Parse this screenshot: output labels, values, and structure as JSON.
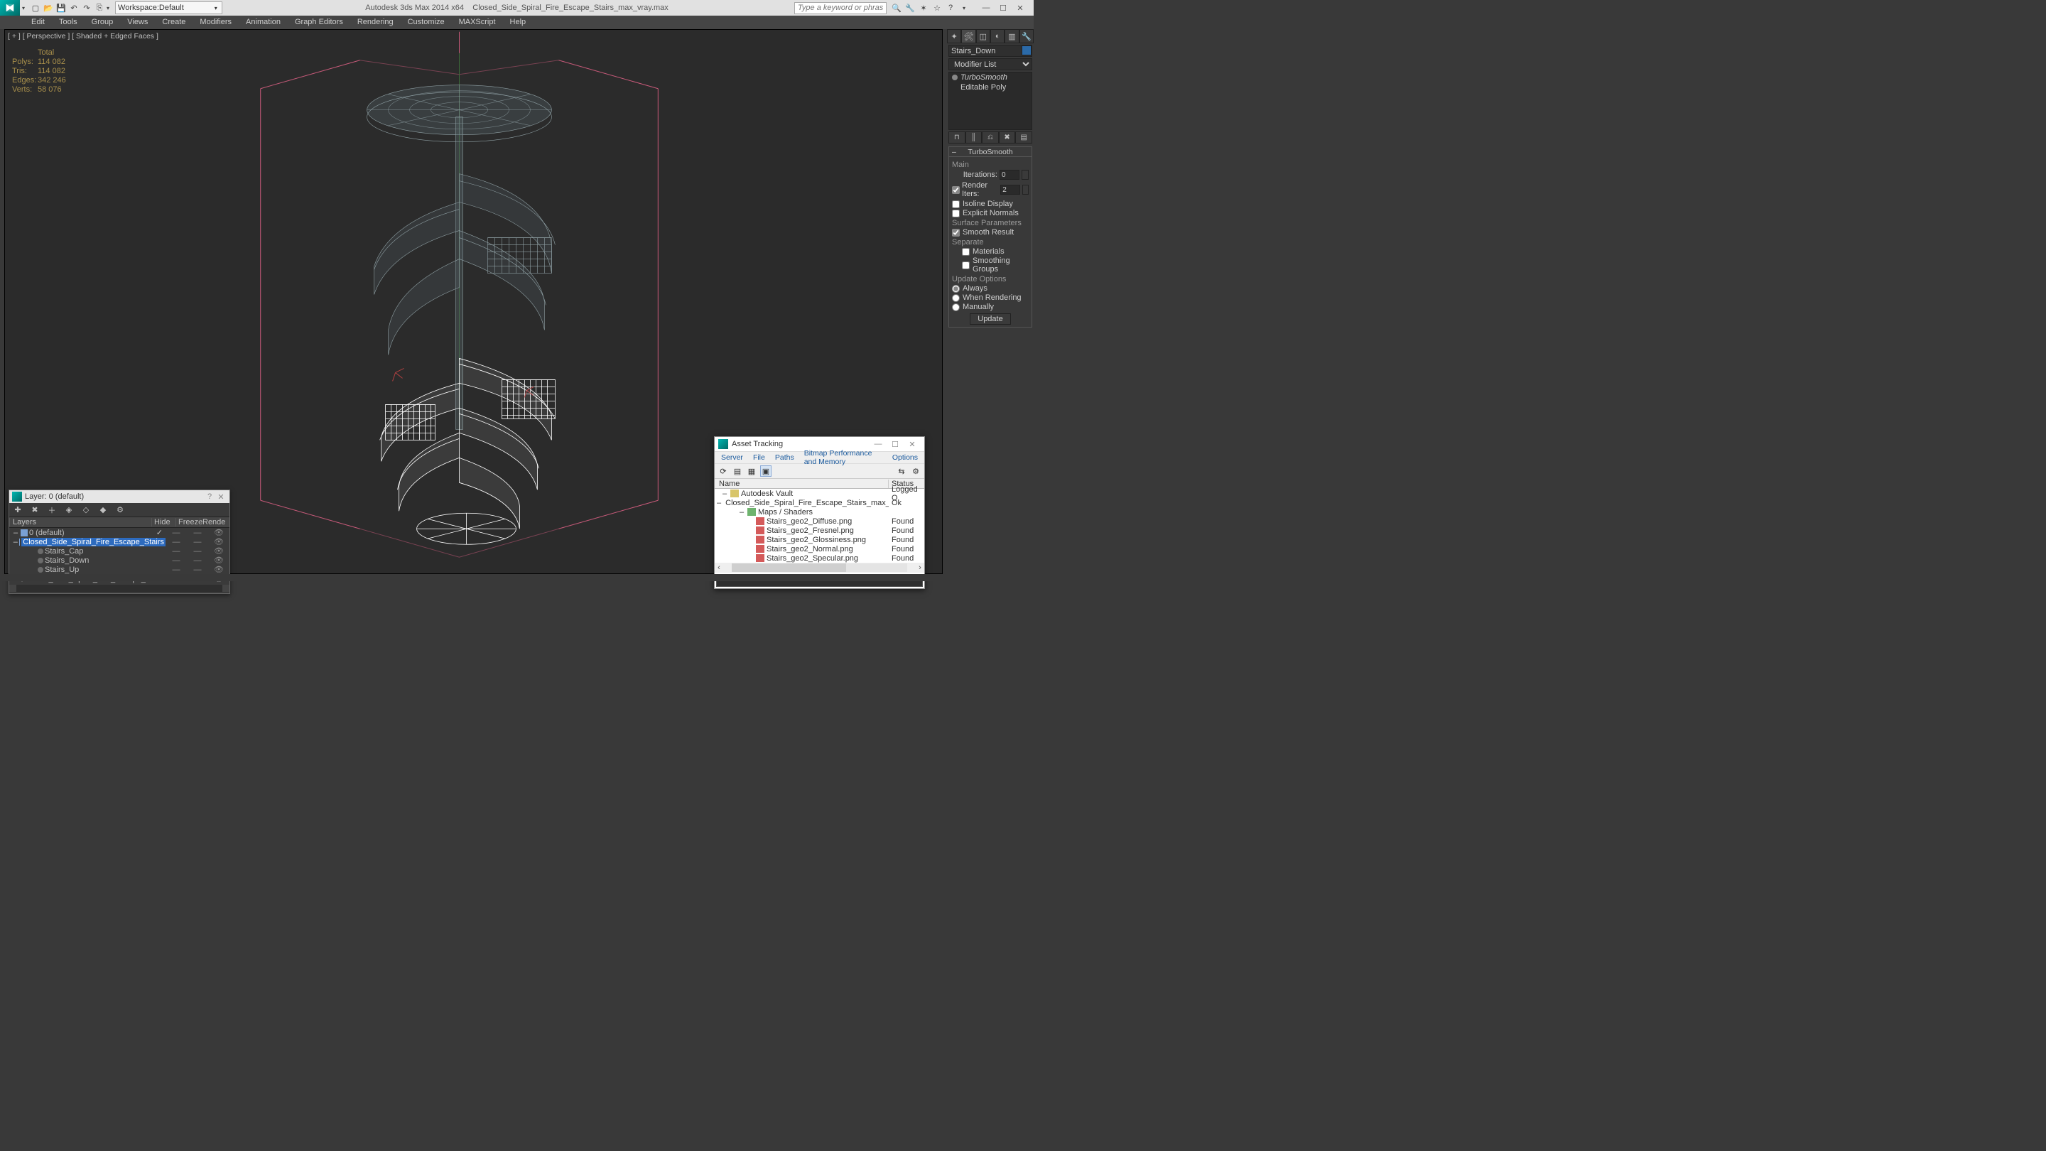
{
  "titlebar": {
    "app_title": "Autodesk 3ds Max 2014 x64",
    "file_name": "Closed_Side_Spiral_Fire_Escape_Stairs_max_vray.max",
    "workspace_prefix": "Workspace: ",
    "workspace_value": "Default",
    "search_placeholder": "Type a keyword or phrase"
  },
  "menubar": [
    "Edit",
    "Tools",
    "Group",
    "Views",
    "Create",
    "Modifiers",
    "Animation",
    "Graph Editors",
    "Rendering",
    "Customize",
    "MAXScript",
    "Help"
  ],
  "viewport": {
    "label": "[ + ] [ Perspective ] [ Shaded + Edged Faces ]",
    "stats": {
      "header": "Total",
      "rows": [
        {
          "k": "Polys:",
          "v": "114 082"
        },
        {
          "k": "Tris:",
          "v": "114 082"
        },
        {
          "k": "Edges:",
          "v": "342 246"
        },
        {
          "k": "Verts:",
          "v": "58 076"
        }
      ]
    }
  },
  "cmdpanel": {
    "object_name": "Stairs_Down",
    "modifier_list_label": "Modifier List",
    "stack": [
      {
        "name": "TurboSmooth",
        "sel": true
      },
      {
        "name": "Editable Poly",
        "sel": false
      }
    ],
    "rollout": {
      "title": "TurboSmooth",
      "main_lbl": "Main",
      "iterations_lbl": "Iterations:",
      "iterations_val": "0",
      "render_iters_lbl": "Render Iters:",
      "render_iters_val": "2",
      "isoline_lbl": "Isoline Display",
      "explicit_lbl": "Explicit Normals",
      "surface_lbl": "Surface Parameters",
      "smooth_result_lbl": "Smooth Result",
      "separate_lbl": "Separate",
      "materials_lbl": "Materials",
      "smoothing_groups_lbl": "Smoothing Groups",
      "update_opts_lbl": "Update Options",
      "always_lbl": "Always",
      "when_rendering_lbl": "When Rendering",
      "manually_lbl": "Manually",
      "update_btn": "Update"
    }
  },
  "layer_dialog": {
    "title": "Layer: 0 (default)",
    "columns": [
      "Layers",
      "Hide",
      "Freeze",
      "Rende"
    ],
    "rows": [
      {
        "indent": 0,
        "icon": "ly",
        "exp": "–",
        "name": "0 (default)",
        "sel": false,
        "check": true
      },
      {
        "indent": 1,
        "icon": "ly",
        "exp": "–",
        "name": "Closed_Side_Spiral_Fire_Escape_Stairs",
        "sel": true,
        "check": false
      },
      {
        "indent": 2,
        "icon": "ob",
        "exp": "",
        "name": "Stairs_Cap",
        "sel": false,
        "check": false
      },
      {
        "indent": 2,
        "icon": "ob",
        "exp": "",
        "name": "Stairs_Down",
        "sel": false,
        "check": false
      },
      {
        "indent": 2,
        "icon": "ob",
        "exp": "",
        "name": "Stairs_Up",
        "sel": false,
        "check": false
      },
      {
        "indent": 2,
        "icon": "ob",
        "exp": "",
        "name": "Closed_Side_Spiral_Fire_Escape_Stairs",
        "sel": false,
        "check": false
      }
    ]
  },
  "asset_dialog": {
    "title": "Asset Tracking",
    "menus": [
      "Server",
      "File",
      "Paths",
      "Bitmap Performance and Memory",
      "Options"
    ],
    "columns": [
      "Name",
      "Status"
    ],
    "rows": [
      {
        "indent": 0,
        "icon": "vault",
        "exp": "–",
        "name": "Autodesk Vault",
        "status": "Logged O"
      },
      {
        "indent": 1,
        "icon": "max",
        "exp": "–",
        "name": "Closed_Side_Spiral_Fire_Escape_Stairs_max_vray.max",
        "status": "Ok"
      },
      {
        "indent": 2,
        "icon": "fld",
        "exp": "–",
        "name": "Maps / Shaders",
        "status": ""
      },
      {
        "indent": 3,
        "icon": "img",
        "exp": "",
        "name": "Stairs_geo2_Diffuse.png",
        "status": "Found"
      },
      {
        "indent": 3,
        "icon": "img",
        "exp": "",
        "name": "Stairs_geo2_Fresnel.png",
        "status": "Found"
      },
      {
        "indent": 3,
        "icon": "img",
        "exp": "",
        "name": "Stairs_geo2_Glossiness.png",
        "status": "Found"
      },
      {
        "indent": 3,
        "icon": "img",
        "exp": "",
        "name": "Stairs_geo2_Normal.png",
        "status": "Found"
      },
      {
        "indent": 3,
        "icon": "img",
        "exp": "",
        "name": "Stairs_geo2_Specular.png",
        "status": "Found"
      }
    ]
  }
}
